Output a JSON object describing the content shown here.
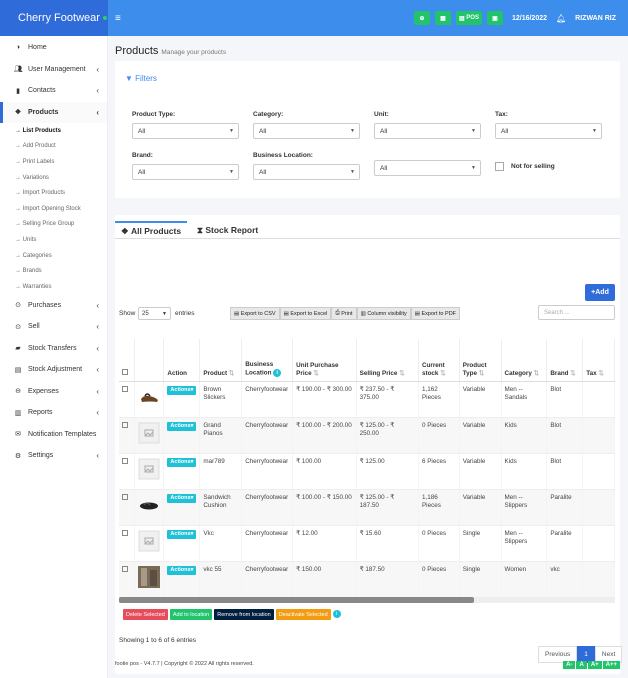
{
  "app": {
    "name": "Cherry Footwear"
  },
  "topbar": {
    "pos_label": "POS",
    "date": "12/16/2022",
    "user": "RIZWAN RIZ"
  },
  "sidebar": {
    "items": [
      {
        "label": "Home",
        "icon": "dashboard-icon"
      },
      {
        "label": "User Management",
        "icon": "users-icon"
      },
      {
        "label": "Contacts",
        "icon": "address-book-icon"
      },
      {
        "label": "Products",
        "icon": "cubes-icon"
      }
    ],
    "sub_items": [
      "List Products",
      "Add Product",
      "Print Labels",
      "Variations",
      "Import Products",
      "Import Opening Stock",
      "Selling Price Group",
      "Units",
      "Categories",
      "Brands",
      "Warranties"
    ],
    "items2": [
      {
        "label": "Purchases",
        "icon": "arrow-circle-down-icon"
      },
      {
        "label": "Sell",
        "icon": "arrow-circle-up-icon"
      },
      {
        "label": "Stock Transfers",
        "icon": "truck-icon"
      },
      {
        "label": "Stock Adjustment",
        "icon": "database-icon"
      },
      {
        "label": "Expenses",
        "icon": "minus-circle-icon"
      },
      {
        "label": "Reports",
        "icon": "bar-chart-icon"
      },
      {
        "label": "Notification Templates",
        "icon": "envelope-icon"
      },
      {
        "label": "Settings",
        "icon": "gear-icon"
      }
    ]
  },
  "page": {
    "title": "Products",
    "subtitle": "Manage your products"
  },
  "filters": {
    "heading": "Filters",
    "product_type": {
      "label": "Product Type:",
      "value": "All"
    },
    "category": {
      "label": "Category:",
      "value": "All"
    },
    "unit": {
      "label": "Unit:",
      "value": "All"
    },
    "tax": {
      "label": "Tax:",
      "value": "All"
    },
    "brand": {
      "label": "Brand:",
      "value": "All"
    },
    "location": {
      "label": "Business Location:",
      "value": "All"
    },
    "extra": {
      "value": "All"
    },
    "not_for_selling": "Not for selling"
  },
  "tabs": {
    "all_products": "All Products",
    "stock_report": "Stock Report"
  },
  "list": {
    "add_label": "Add",
    "show": "Show",
    "entries_value": "25",
    "entries": "entries",
    "export_csv": "Export to CSV",
    "export_excel": "Export to Excel",
    "print": "Print",
    "column_visibility": "Column visibility",
    "export_pdf": "Export to PDF",
    "search_placeholder": "Search ...",
    "columns": [
      "",
      "",
      "Action",
      "Product",
      "Business Location",
      "Unit Purchase Price",
      "Selling Price",
      "Current stock",
      "Product Type",
      "Category",
      "Brand",
      "Tax"
    ],
    "action_label": "Actions",
    "rows": [
      {
        "product": "Brown Slickers",
        "location": "Cherryfootwear",
        "purchase": "₹ 190.00 - ₹ 300.00",
        "selling": "₹ 237.50 - ₹ 375.00",
        "stock": "1,162 Pieces",
        "type": "Variable",
        "category": "Men -- Sandals",
        "brand": "Blot",
        "thumb": "sandal"
      },
      {
        "product": "Grand Pianos",
        "location": "Cherryfootwear",
        "purchase": "₹ 100.00 - ₹ 200.00",
        "selling": "₹ 125.00 - ₹ 250.00",
        "stock": "0 Pieces",
        "type": "Variable",
        "category": "Kids",
        "brand": "Blot",
        "thumb": "placeholder"
      },
      {
        "product": "mar789",
        "location": "Cherryfootwear",
        "purchase": "₹ 100.00",
        "selling": "₹ 125.00",
        "stock": "6 Pieces",
        "type": "Variable",
        "category": "Kids",
        "brand": "Blot",
        "thumb": "placeholder"
      },
      {
        "product": "Sandwich Cushion",
        "location": "Cherryfootwear",
        "purchase": "₹ 100.00 - ₹ 150.00",
        "selling": "₹ 125.00 - ₹ 187.50",
        "stock": "1,186 Pieces",
        "type": "Variable",
        "category": "Men -- Slippers",
        "brand": "Paralite",
        "thumb": "slipper"
      },
      {
        "product": "Vkc",
        "location": "Cherryfootwear",
        "purchase": "₹ 12.00",
        "selling": "₹ 15.60",
        "stock": "0 Pieces",
        "type": "Single",
        "category": "Men -- Slippers",
        "brand": "Paralite",
        "thumb": "placeholder"
      },
      {
        "product": "vkc 55",
        "location": "Cherryfootwear",
        "purchase": "₹ 150.00",
        "selling": "₹ 187.50",
        "stock": "0 Pieces",
        "type": "Single",
        "category": "Women",
        "brand": "vkc",
        "thumb": "photo"
      }
    ],
    "bulk": {
      "delete": "Delete Selected",
      "add_location": "Add to location",
      "remove_location": "Remove from location",
      "deactivate": "Deactivate Selected"
    },
    "showing": "Showing 1 to 6 of 6 entries",
    "previous": "Previous",
    "page": "1",
    "next": "Next"
  },
  "footer": {
    "text": "footie pos - V4.7.7 | Copyright © 2022 All rights reserved.",
    "font_buttons": [
      "A-",
      "A",
      "A+",
      "A++"
    ]
  },
  "colors": {
    "primary": "#3c8dec",
    "brand": "#2f6bd9",
    "green": "#21c36b",
    "teal": "#1fc1d6",
    "danger": "#e74c5a",
    "warning": "#f39c12",
    "dark": "#001f3f"
  }
}
